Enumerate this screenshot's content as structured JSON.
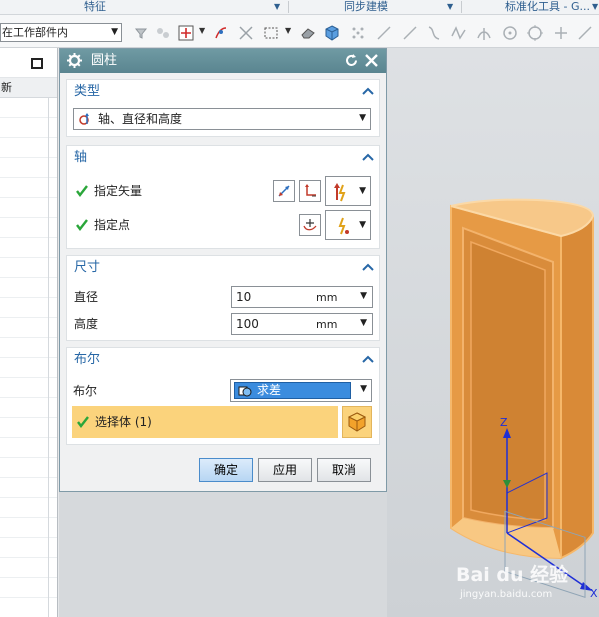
{
  "ribbon": {
    "groups": [
      {
        "label": "特征"
      },
      {
        "label": "同步建模"
      },
      {
        "label": "标准化工具 - G..."
      }
    ]
  },
  "toolbar": {
    "scope_value": "在工作部件内"
  },
  "part_navigator": {
    "column_header": "新"
  },
  "dialog": {
    "title": "圆柱",
    "sections": {
      "type": {
        "label": "类型",
        "value": "轴、直径和高度"
      },
      "axis": {
        "label": "轴",
        "vector_label": "指定矢量",
        "point_label": "指定点"
      },
      "dimensions": {
        "label": "尺寸",
        "diameter_label": "直径",
        "diameter_value": "10",
        "diameter_unit": "mm",
        "height_label": "高度",
        "height_value": "100",
        "height_unit": "mm"
      },
      "boolean": {
        "label": "布尔",
        "bool_label": "布尔",
        "bool_value": "求差",
        "select_body": "选择体 (1)"
      }
    },
    "buttons": {
      "ok": "确定",
      "apply": "应用",
      "cancel": "取消"
    }
  },
  "graphics": {
    "axis_labels": {
      "z": "Z",
      "x": "X"
    },
    "model_color": "#f0a14a"
  },
  "watermark": {
    "logo": "Bai du 经验",
    "url": "jingyan.baidu.com"
  },
  "colors": {
    "dialog_title_bar": "#5f8c96",
    "section_header": "#2767a6",
    "highlight": "#3b8cde",
    "selection_bg": "#fbd37c",
    "check": "#2aa63a"
  }
}
